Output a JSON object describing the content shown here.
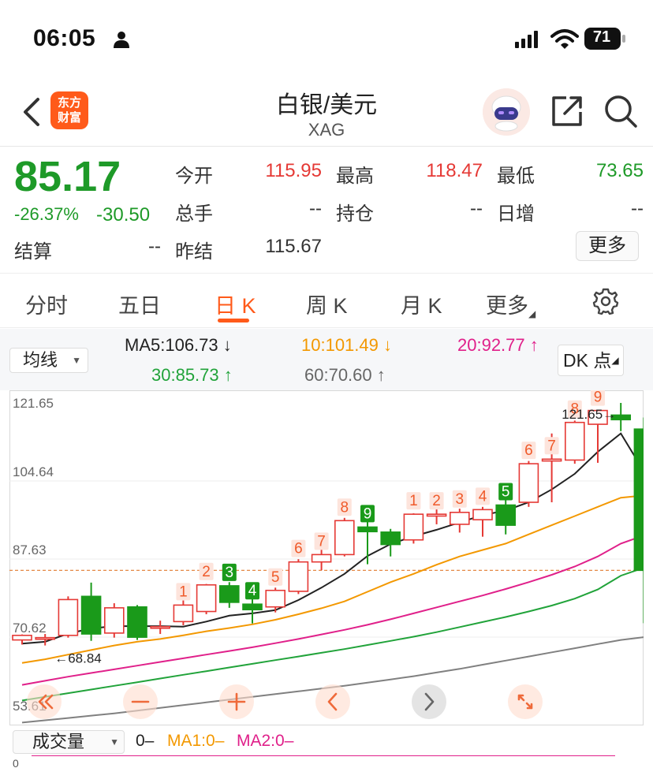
{
  "status": {
    "time": "06:05",
    "battery": "71"
  },
  "nav": {
    "logo_line1": "东方",
    "logo_line2": "财富",
    "title": "白银/美元",
    "subtitle": "XAG"
  },
  "quote": {
    "price": "85.17",
    "change_pct": "-26.37%",
    "change": "-30.50",
    "open_label": "今开",
    "open_value": "115.95",
    "high_label": "最高",
    "high_value": "118.47",
    "low_label": "最低",
    "low_value": "73.65",
    "volume_label": "总手",
    "volume_value": "--",
    "position_label": "持仓",
    "position_value": "--",
    "daily_inc_label": "日增",
    "daily_inc_value": "--",
    "settle_label": "结算",
    "settle_value": "--",
    "prev_settle_label": "昨结",
    "prev_settle_value": "115.67",
    "more_label": "更多"
  },
  "tabs": [
    {
      "label": "分时"
    },
    {
      "label": "五日"
    },
    {
      "label": "日 K"
    },
    {
      "label": "周 K"
    },
    {
      "label": "月 K"
    },
    {
      "label": "更多"
    }
  ],
  "ma": {
    "select_label": "均线",
    "ma5": "MA5:106.73",
    "ma10": "10:101.49",
    "ma20": "20:92.77",
    "ma30": "30:85.73",
    "ma60": "60:70.60",
    "dk_label": "DK 点"
  },
  "colors": {
    "up": "#e53935",
    "down": "#1a9a1a",
    "accent": "#ff5a1a",
    "ma5": "#222222",
    "ma10": "#f39800",
    "ma20": "#e0208a",
    "ma30": "#21a33a",
    "ma60": "#808080"
  },
  "chart_data": {
    "type": "candlestick",
    "y_ticks": [
      "121.65",
      "104.64",
      "87.63",
      "70.62",
      "53.61"
    ],
    "ylim": [
      53.61,
      121.65
    ],
    "max_marker": "121.65→",
    "min_marker": "←68.84",
    "last_close": 85.17,
    "candles": [
      {
        "o": 70.0,
        "h": 71.2,
        "l": 69.0,
        "c": 71.0,
        "label": ""
      },
      {
        "o": 70.3,
        "h": 71.3,
        "l": 68.8,
        "c": 70.5,
        "label": ""
      },
      {
        "o": 71.0,
        "h": 79.5,
        "l": 70.5,
        "c": 78.8,
        "label": ""
      },
      {
        "o": 79.5,
        "h": 82.5,
        "l": 69.8,
        "c": 71.3,
        "label": ""
      },
      {
        "o": 71.5,
        "h": 78.0,
        "l": 70.5,
        "c": 77.0,
        "label": ""
      },
      {
        "o": 77.2,
        "h": 77.6,
        "l": 70.0,
        "c": 70.6,
        "label": ""
      },
      {
        "o": 72.6,
        "h": 74.2,
        "l": 71.3,
        "c": 72.9,
        "label": ""
      },
      {
        "o": 74.0,
        "h": 78.6,
        "l": 73.2,
        "c": 77.6,
        "label": "1"
      },
      {
        "o": 76.2,
        "h": 82.2,
        "l": 75.6,
        "c": 82.0,
        "label": "2"
      },
      {
        "o": 81.8,
        "h": 82.6,
        "l": 77.0,
        "c": 78.2,
        "label": "3"
      },
      {
        "o": 77.8,
        "h": 79.2,
        "l": 73.6,
        "c": 76.6,
        "label": "4"
      },
      {
        "o": 77.2,
        "h": 81.4,
        "l": 76.0,
        "c": 80.8,
        "label": "5"
      },
      {
        "o": 80.6,
        "h": 87.6,
        "l": 80.0,
        "c": 87.0,
        "label": "6"
      },
      {
        "o": 87.0,
        "h": 90.4,
        "l": 85.2,
        "c": 88.6,
        "label": "7"
      },
      {
        "o": 88.6,
        "h": 96.6,
        "l": 88.2,
        "c": 96.0,
        "label": "8"
      },
      {
        "o": 94.6,
        "h": 96.2,
        "l": 86.5,
        "c": 93.6,
        "label": "9"
      },
      {
        "o": 93.5,
        "h": 94.2,
        "l": 88.2,
        "c": 90.8,
        "label": ""
      },
      {
        "o": 91.8,
        "h": 97.6,
        "l": 91.0,
        "c": 97.4,
        "label": "1"
      },
      {
        "o": 97.0,
        "h": 99.6,
        "l": 95.2,
        "c": 97.4,
        "label": "2"
      },
      {
        "o": 95.2,
        "h": 98.6,
        "l": 93.4,
        "c": 97.8,
        "label": "3"
      },
      {
        "o": 96.2,
        "h": 99.0,
        "l": 92.5,
        "c": 98.4,
        "label": "4"
      },
      {
        "o": 99.4,
        "h": 101.0,
        "l": 93.0,
        "c": 95.0,
        "label": "5"
      },
      {
        "o": 100.0,
        "h": 109.0,
        "l": 99.0,
        "c": 108.4,
        "label": "6"
      },
      {
        "o": 109.0,
        "h": 115.0,
        "l": 100.0,
        "c": 109.4,
        "label": "7"
      },
      {
        "o": 109.2,
        "h": 117.8,
        "l": 108.4,
        "c": 117.4,
        "label": "8"
      },
      {
        "o": 117.0,
        "h": 120.0,
        "l": 108.6,
        "c": 120.0,
        "label": "9"
      },
      {
        "o": 119.0,
        "h": 121.65,
        "l": 115.5,
        "c": 118.0,
        "label": ""
      },
      {
        "o": 115.95,
        "h": 118.47,
        "l": 73.65,
        "c": 85.17,
        "label": ""
      }
    ],
    "ma5": [
      69.2,
      69.6,
      71.4,
      72.5,
      73.0,
      73.0,
      73.0,
      72.9,
      74.0,
      75.3,
      75.8,
      76.5,
      78.7,
      81.4,
      84.4,
      88.3,
      90.9,
      92.6,
      94.0,
      95.6,
      97.2,
      98.2,
      100.0,
      102.8,
      106.2,
      111.0,
      115.0,
      106.73
    ],
    "ma10": [
      65.0,
      65.8,
      66.8,
      67.8,
      68.8,
      69.6,
      70.2,
      71.0,
      71.9,
      72.6,
      73.4,
      74.4,
      75.6,
      76.9,
      78.4,
      80.5,
      82.6,
      84.4,
      86.4,
      88.2,
      89.6,
      91.0,
      93.0,
      95.0,
      97.0,
      99.0,
      101.0,
      101.49
    ],
    "ma20": [
      60.2,
      61.1,
      62.0,
      62.8,
      63.6,
      64.4,
      65.2,
      66.0,
      66.8,
      67.6,
      68.4,
      69.3,
      70.2,
      71.2,
      72.2,
      73.3,
      74.5,
      75.8,
      77.1,
      78.4,
      79.7,
      81.1,
      82.6,
      84.2,
      86.0,
      88.2,
      91.0,
      92.77
    ],
    "ma30": [
      56.8,
      57.6,
      58.4,
      59.2,
      60.0,
      60.8,
      61.6,
      62.4,
      63.2,
      64.0,
      64.8,
      65.6,
      66.4,
      67.2,
      68.0,
      68.9,
      69.8,
      70.7,
      71.7,
      72.8,
      73.9,
      75.0,
      76.2,
      77.5,
      79.0,
      81.0,
      84.0,
      85.73
    ],
    "ma60": [
      52.0,
      52.5,
      53.0,
      53.5,
      54.0,
      54.6,
      55.2,
      55.8,
      56.4,
      57.0,
      57.6,
      58.2,
      58.8,
      59.4,
      60.0,
      60.7,
      61.4,
      62.1,
      62.9,
      63.7,
      64.6,
      65.5,
      66.4,
      67.3,
      68.2,
      69.1,
      70.0,
      70.6
    ]
  },
  "volume": {
    "select_label": "成交量",
    "v0": "0–",
    "ma1": "MA1:0–",
    "ma2": "MA2:0–",
    "zero": "0"
  },
  "chart_controls": [
    "rewind-icon",
    "zoom-out-icon",
    "zoom-in-icon",
    "scroll-left-icon",
    "scroll-right-icon",
    "fullscreen-icon"
  ]
}
